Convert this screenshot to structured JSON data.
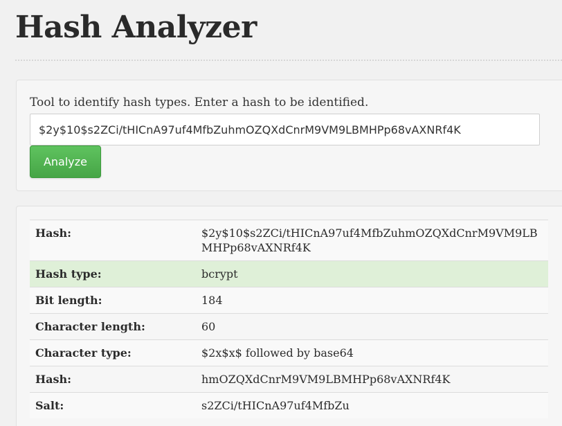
{
  "page": {
    "title": "Hash Analyzer"
  },
  "form": {
    "intro": "Tool to identify hash types. Enter a hash to be identified.",
    "hash_value": "$2y$10$s2ZCi/tHICnA97uf4MfbZuhmOZQXdCnrM9VM9LBMHPp68vAXNRf4K",
    "analyze_label": "Analyze"
  },
  "results": {
    "rows": [
      {
        "label": "Hash:",
        "value": "$2y$10$s2ZCi/tHICnA97uf4MfbZuhmOZQXdCnrM9VM9LBMHPp68vAXNRf4K"
      },
      {
        "label": "Hash type:",
        "value": "bcrypt"
      },
      {
        "label": "Bit length:",
        "value": "184"
      },
      {
        "label": "Character length:",
        "value": "60"
      },
      {
        "label": "Character type:",
        "value": "$2x$x$ followed by base64"
      },
      {
        "label": "Hash:",
        "value": "hmOZQXdCnrM9VM9LBMHPp68vAXNRf4K"
      },
      {
        "label": "Salt:",
        "value": "s2ZCi/tHICnA97uf4MfbZu"
      }
    ]
  },
  "colors": {
    "page_background": "#f1f1f1",
    "button_green": "#4cae4c",
    "highlight_row": "#dff0d8"
  }
}
